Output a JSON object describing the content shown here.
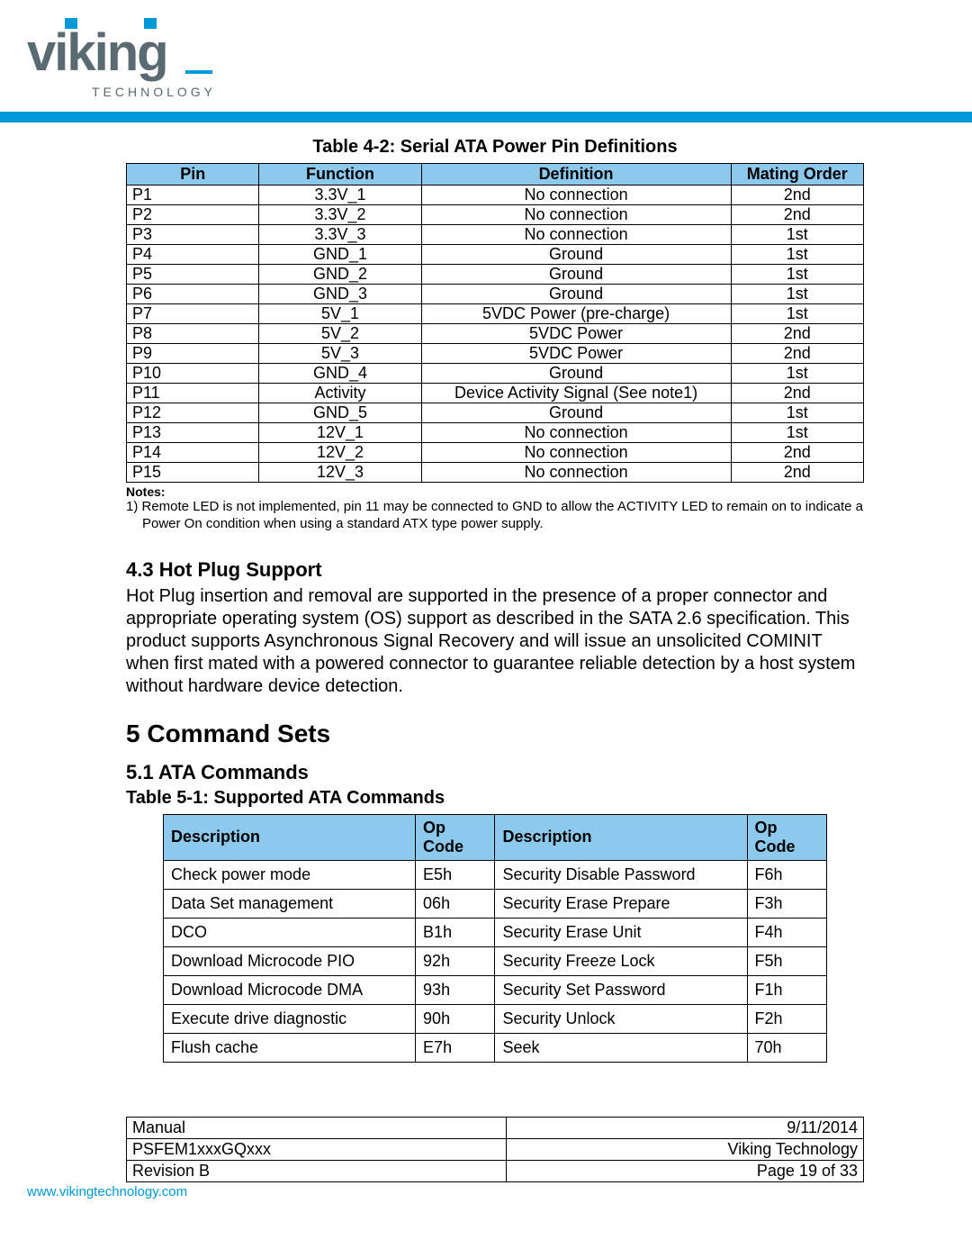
{
  "logo": {
    "brand": "viking",
    "sub": "TECHNOLOGY"
  },
  "table42": {
    "caption": "Table 4-2: Serial ATA Power Pin Definitions",
    "headers": [
      "Pin",
      "Function",
      "Definition",
      "Mating Order"
    ],
    "rows": [
      [
        "P1",
        "3.3V_1",
        "No connection",
        "2nd"
      ],
      [
        "P2",
        "3.3V_2",
        "No connection",
        "2nd"
      ],
      [
        "P3",
        "3.3V_3",
        "No connection",
        "1st"
      ],
      [
        "P4",
        "GND_1",
        "Ground",
        "1st"
      ],
      [
        "P5",
        "GND_2",
        "Ground",
        "1st"
      ],
      [
        "P6",
        "GND_3",
        "Ground",
        "1st"
      ],
      [
        "P7",
        "5V_1",
        "5VDC Power (pre-charge)",
        "1st"
      ],
      [
        "P8",
        "5V_2",
        "5VDC Power",
        "2nd"
      ],
      [
        "P9",
        "5V_3",
        "5VDC Power",
        "2nd"
      ],
      [
        "P10",
        "GND_4",
        "Ground",
        "1st"
      ],
      [
        "P11",
        "Activity",
        "Device Activity Signal (See note1)",
        "2nd"
      ],
      [
        "P12",
        "GND_5",
        "Ground",
        "1st"
      ],
      [
        "P13",
        "12V_1",
        "No connection",
        "1st"
      ],
      [
        "P14",
        "12V_2",
        "No connection",
        "2nd"
      ],
      [
        "P15",
        "12V_3",
        "No connection",
        "2nd"
      ]
    ],
    "notes_label": "Notes:",
    "notes_body": "1)  Remote LED is not implemented, pin 11 may be connected to GND to allow the ACTIVITY LED to remain on to indicate a Power On condition when using a standard ATX type power supply."
  },
  "sec43": {
    "heading": "4.3  Hot Plug Support",
    "body": "Hot Plug insertion and removal are supported in the presence of a proper connector and appropriate operating system (OS) support as described in the SATA 2.6 specification. This product supports Asynchronous Signal Recovery and will issue an unsolicited COMINIT when first mated with a powered connector to guarantee reliable detection by a host system without hardware device detection."
  },
  "chap5": {
    "heading": "5   Command Sets"
  },
  "sec51": {
    "heading": "5.1  ATA Commands",
    "table_caption": "Table 5-1: Supported ATA Commands",
    "headers": [
      "Description",
      "Op Code",
      "Description",
      "Op Code"
    ],
    "rows": [
      [
        "Check power mode",
        "E5h",
        "Security Disable Password",
        "F6h"
      ],
      [
        "Data Set management",
        "06h",
        "Security Erase Prepare",
        "F3h"
      ],
      [
        "DCO",
        "B1h",
        "Security Erase Unit",
        "F4h"
      ],
      [
        "Download Microcode PIO",
        "92h",
        "Security Freeze Lock",
        "F5h"
      ],
      [
        "Download Microcode DMA",
        "93h",
        "Security Set Password",
        "F1h"
      ],
      [
        "Execute drive diagnostic",
        "90h",
        "Security Unlock",
        "F2h"
      ],
      [
        "Flush cache",
        "E7h",
        "Seek",
        "70h"
      ]
    ]
  },
  "footer": {
    "r1l": "Manual",
    "r1r": "9/11/2014",
    "r2l": "PSFEM1xxxGQxxx",
    "r2r": "Viking Technology",
    "r3l": "Revision B",
    "r3r": "Page 19 of 33",
    "url": "www.vikingtechnology.com"
  }
}
